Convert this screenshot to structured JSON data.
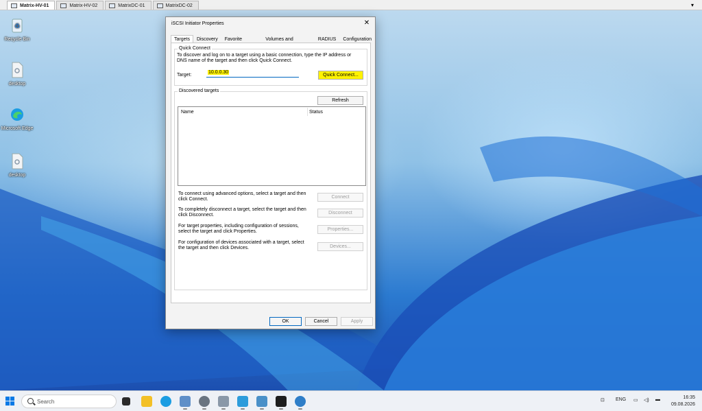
{
  "vm_tabs": [
    {
      "label": "Matrix-HV-01",
      "active": true
    },
    {
      "label": "Matrix-HV-02",
      "active": false
    },
    {
      "label": "MatrixDC-01",
      "active": false
    },
    {
      "label": "MatrixDC-02",
      "active": false
    }
  ],
  "desktop_icons": [
    {
      "label": "Recycle Bin",
      "icon": "recycle-bin-icon"
    },
    {
      "label": "desktop",
      "icon": "file-icon"
    },
    {
      "label": "Microsoft Edge",
      "icon": "edge-icon"
    },
    {
      "label": "desktop",
      "icon": "file-icon"
    }
  ],
  "dialog": {
    "title": "iSCSI Initiator Properties",
    "close": "✕",
    "tabs": [
      "Targets",
      "Discovery",
      "Favorite Targets",
      "Volumes and Devices",
      "RADIUS",
      "Configuration"
    ],
    "active_tab": "Targets",
    "quick_connect": {
      "title": "Quick Connect",
      "description": "To discover and log on to a target using a basic connection, type the IP address or DNS name of the target and then click Quick Connect.",
      "target_label": "Target:",
      "target_value": "10.0.0.30",
      "button": "Quick Connect..."
    },
    "discovered": {
      "title": "Discovered targets",
      "refresh": "Refresh",
      "columns": [
        "Name",
        "Status"
      ],
      "rows": []
    },
    "actions": [
      {
        "text": "To connect using advanced options, select a target and then click Connect.",
        "button": "Connect"
      },
      {
        "text": "To completely disconnect a target, select the target and then click Disconnect.",
        "button": "Disconnect"
      },
      {
        "text": "For target properties, including configuration of sessions, select the target and click Properties.",
        "button": "Properties..."
      },
      {
        "text": "For configuration of devices associated with a target, select the target and then click Devices.",
        "button": "Devices..."
      }
    ],
    "footer": {
      "ok": "OK",
      "cancel": "Cancel",
      "apply": "Apply"
    }
  },
  "taskbar": {
    "search_placeholder": "Search",
    "tray_language": "ENG",
    "time": "16:35",
    "date": "09.08.2026"
  },
  "colors": {
    "highlight": "#fff200",
    "accent": "#0067c0"
  }
}
